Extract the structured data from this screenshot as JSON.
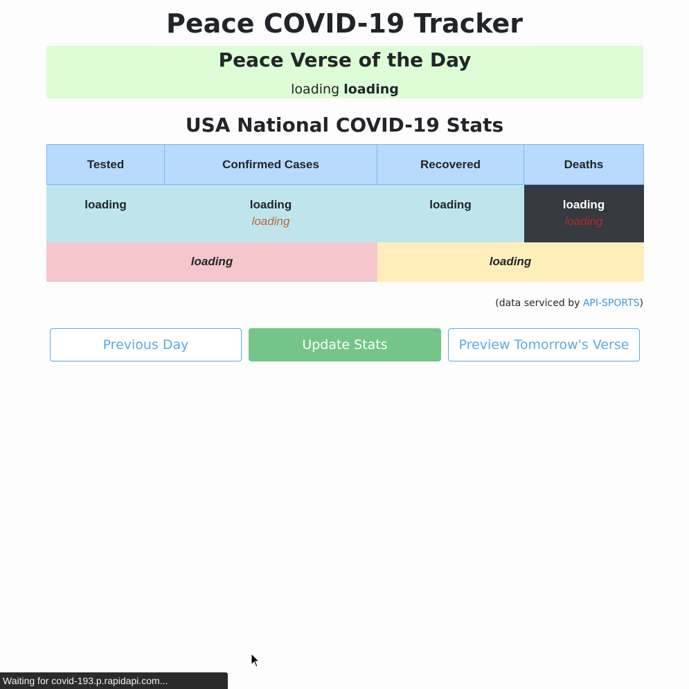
{
  "page": {
    "title": "Peace COVID-19 Tracker"
  },
  "verse": {
    "heading": "Peace Verse of the Day",
    "text": "loading",
    "reference": "loading"
  },
  "stats": {
    "heading": "USA National COVID-19 Stats",
    "columns": [
      "Tested",
      "Confirmed Cases",
      "Recovered",
      "Deaths"
    ],
    "tested": "loading",
    "confirmed": "loading",
    "confirmed_new": "loading",
    "recovered": "loading",
    "deaths": "loading",
    "deaths_new": "loading",
    "active_summary": "loading",
    "critical_summary": "loading"
  },
  "attribution": {
    "prefix": "(data serviced by ",
    "link": "API-SPORTS",
    "suffix": ")"
  },
  "buttons": {
    "previous": "Previous Day",
    "update": "Update Stats",
    "preview": "Preview Tomorrow's Verse"
  },
  "status_bar": {
    "text": "Waiting for covid-193.p.rapidapi.com..."
  },
  "colors": {
    "verse_bg": "#dcfdd5",
    "header_bg": "#b8daff",
    "info_bg": "#bee5eb",
    "dark_bg": "#343a40",
    "danger_bg": "#f5c6cb",
    "warning_bg": "#ffeeba",
    "primary": "#5aa9e6",
    "success": "#74c587"
  }
}
